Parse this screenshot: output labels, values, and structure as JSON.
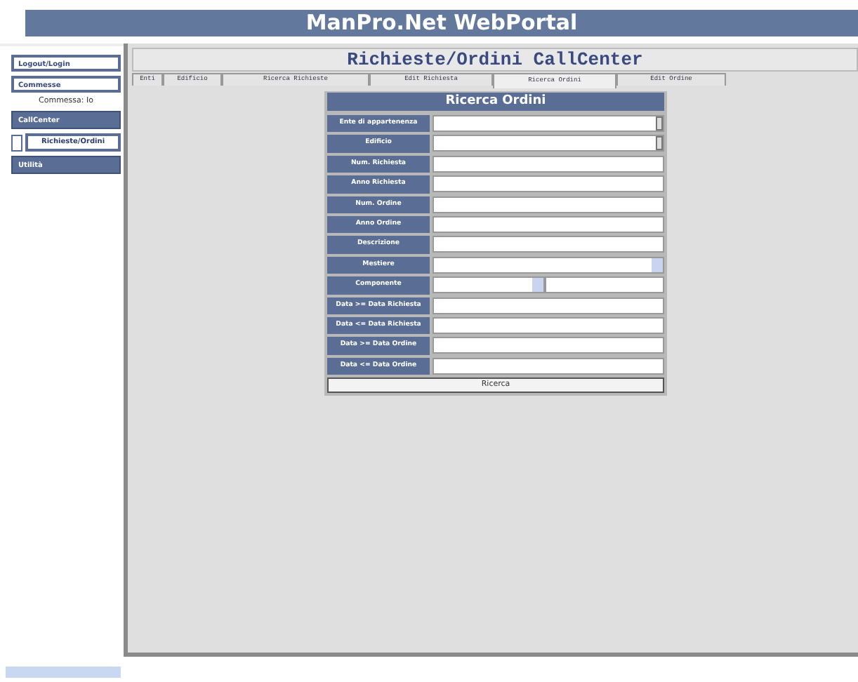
{
  "header": {
    "title": "ManPro.Net WebPortal"
  },
  "sidebar": {
    "items": [
      {
        "kind": "link",
        "label": "Logout/Login"
      },
      {
        "kind": "link",
        "label": "Commesse"
      },
      {
        "kind": "info",
        "label": "Commessa: Io"
      },
      {
        "kind": "section",
        "label": "CallCenter"
      },
      {
        "kind": "sub",
        "label": "Richieste/Ordini",
        "selected": true
      },
      {
        "kind": "section",
        "label": "Utilità"
      }
    ]
  },
  "page": {
    "title": "Richieste/Ordini CallCenter"
  },
  "tabs": [
    {
      "label": "Enti",
      "selected": false
    },
    {
      "label": "Edificio",
      "selected": false
    },
    {
      "label": "Ricerca Richieste",
      "selected": false
    },
    {
      "label": "Edit Richiesta",
      "selected": false
    },
    {
      "label": "Ricerca Ordini",
      "selected": true
    },
    {
      "label": "Edit Ordine",
      "selected": false
    }
  ],
  "form": {
    "title": "Ricerca Ordini",
    "fields": [
      {
        "label": "Ente di appartenenza",
        "kind": "spin"
      },
      {
        "label": "Edificio",
        "kind": "spin"
      },
      {
        "label": "Num. Richiesta",
        "kind": "text"
      },
      {
        "label": "Anno Richiesta",
        "kind": "text"
      },
      {
        "label": "Num. Ordine",
        "kind": "text"
      },
      {
        "label": "Anno Ordine",
        "kind": "text"
      },
      {
        "label": "Descrizione",
        "kind": "text"
      },
      {
        "label": "Mestiere",
        "kind": "select"
      },
      {
        "label": "Componente",
        "kind": "select-short"
      },
      {
        "label": "Data >= Data Richiesta",
        "kind": "text"
      },
      {
        "label": "Data <= Data Richiesta",
        "kind": "text"
      },
      {
        "label": "Data >= Data Ordine",
        "kind": "text"
      },
      {
        "label": "Data <= Data Ordine",
        "kind": "text"
      }
    ],
    "button": "Ricerca"
  }
}
